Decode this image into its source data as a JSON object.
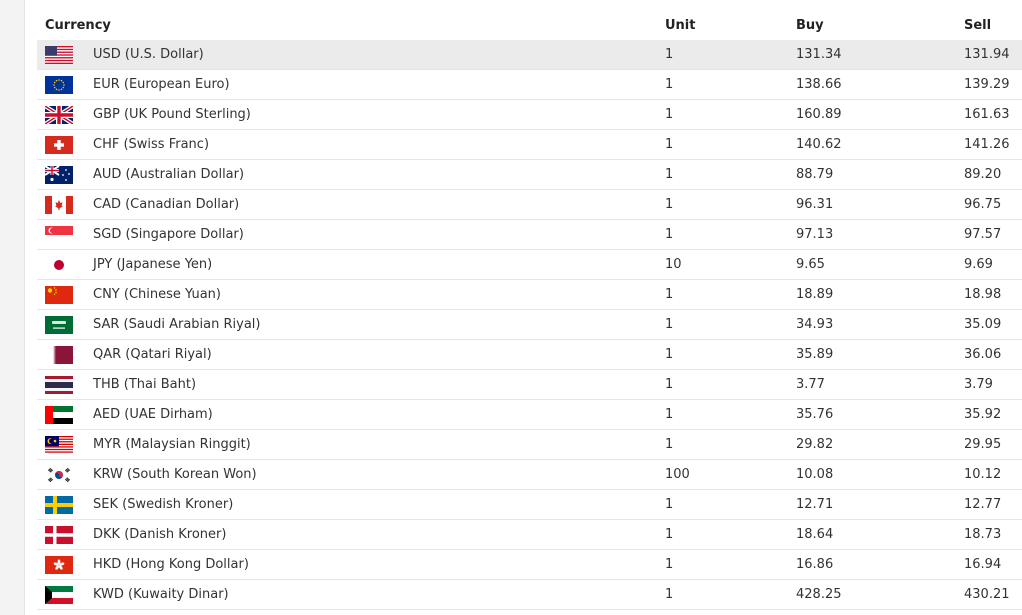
{
  "table": {
    "headers": {
      "currency": "Currency",
      "unit": "Unit",
      "buy": "Buy",
      "sell": "Sell"
    },
    "rows": [
      {
        "flag": "us-flag-icon",
        "currency": "USD (U.S. Dollar)",
        "unit": "1",
        "buy": "131.34",
        "sell": "131.94"
      },
      {
        "flag": "eu-flag-icon",
        "currency": "EUR (European Euro)",
        "unit": "1",
        "buy": "138.66",
        "sell": "139.29"
      },
      {
        "flag": "gb-flag-icon",
        "currency": "GBP (UK Pound Sterling)",
        "unit": "1",
        "buy": "160.89",
        "sell": "161.63"
      },
      {
        "flag": "ch-flag-icon",
        "currency": "CHF (Swiss Franc)",
        "unit": "1",
        "buy": "140.62",
        "sell": "141.26"
      },
      {
        "flag": "au-flag-icon",
        "currency": "AUD (Australian Dollar)",
        "unit": "1",
        "buy": "88.79",
        "sell": "89.20"
      },
      {
        "flag": "ca-flag-icon",
        "currency": "CAD (Canadian Dollar)",
        "unit": "1",
        "buy": "96.31",
        "sell": "96.75"
      },
      {
        "flag": "sg-flag-icon",
        "currency": "SGD (Singapore Dollar)",
        "unit": "1",
        "buy": "97.13",
        "sell": "97.57"
      },
      {
        "flag": "jp-flag-icon",
        "currency": "JPY (Japanese Yen)",
        "unit": "10",
        "buy": "9.65",
        "sell": "9.69"
      },
      {
        "flag": "cn-flag-icon",
        "currency": "CNY (Chinese Yuan)",
        "unit": "1",
        "buy": "18.89",
        "sell": "18.98"
      },
      {
        "flag": "sa-flag-icon",
        "currency": "SAR (Saudi Arabian Riyal)",
        "unit": "1",
        "buy": "34.93",
        "sell": "35.09"
      },
      {
        "flag": "qa-flag-icon",
        "currency": "QAR (Qatari Riyal)",
        "unit": "1",
        "buy": "35.89",
        "sell": "36.06"
      },
      {
        "flag": "th-flag-icon",
        "currency": "THB (Thai Baht)",
        "unit": "1",
        "buy": "3.77",
        "sell": "3.79"
      },
      {
        "flag": "ae-flag-icon",
        "currency": "AED (UAE Dirham)",
        "unit": "1",
        "buy": "35.76",
        "sell": "35.92"
      },
      {
        "flag": "my-flag-icon",
        "currency": "MYR (Malaysian Ringgit)",
        "unit": "1",
        "buy": "29.82",
        "sell": "29.95"
      },
      {
        "flag": "kr-flag-icon",
        "currency": "KRW (South Korean Won)",
        "unit": "100",
        "buy": "10.08",
        "sell": "10.12"
      },
      {
        "flag": "se-flag-icon",
        "currency": "SEK (Swedish Kroner)",
        "unit": "1",
        "buy": "12.71",
        "sell": "12.77"
      },
      {
        "flag": "dk-flag-icon",
        "currency": "DKK (Danish Kroner)",
        "unit": "1",
        "buy": "18.64",
        "sell": "18.73"
      },
      {
        "flag": "hk-flag-icon",
        "currency": "HKD (Hong Kong Dollar)",
        "unit": "1",
        "buy": "16.86",
        "sell": "16.94"
      },
      {
        "flag": "kw-flag-icon",
        "currency": "KWD (Kuwaity Dinar)",
        "unit": "1",
        "buy": "428.25",
        "sell": "430.21"
      }
    ]
  }
}
